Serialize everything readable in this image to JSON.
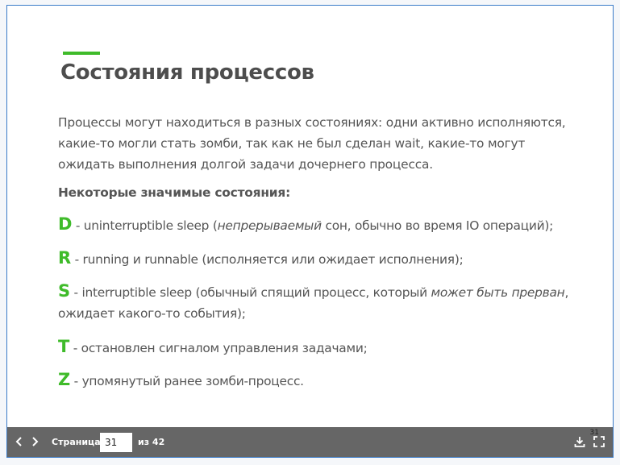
{
  "slide": {
    "title": "Состояния процессов",
    "intro": "Процессы могут находиться в разных состояниях: одни активно исполняются, какие-то могли стать зомби, так как не был сделан wait, какие-то могут ожидать выполнения долгой задачи дочернего процесса.",
    "subhead": "Некоторые значимые состояния:",
    "states": [
      {
        "letter": "D",
        "pre": " - uninterruptible sleep (",
        "italic": "непрерываемый",
        "post": " сон, обычно во время IO операций);"
      },
      {
        "letter": "R",
        "pre": " - running и runnable (исполняется или ожидает исполнения);",
        "italic": "",
        "post": ""
      },
      {
        "letter": "S",
        "pre": " - interruptible sleep (обычный спящий процесс, который ",
        "italic": "может быть прерван",
        "post": ", ожидает какого-то события);"
      },
      {
        "letter": "T",
        "pre": " - остановлен сигналом управления задачами;",
        "italic": "",
        "post": ""
      },
      {
        "letter": "Z",
        "pre": " - упомянутый ранее зомби-процесс.",
        "italic": "",
        "post": ""
      }
    ]
  },
  "toolbar": {
    "page_label": "Страница",
    "page_value": "31",
    "of_label": "из 42",
    "corner_number": "31"
  },
  "colors": {
    "accent": "#3fbb2a",
    "toolbar_bg": "#666666",
    "text": "#555555"
  },
  "icons": [
    "chevron-left-icon",
    "chevron-right-icon",
    "download-icon",
    "fullscreen-icon"
  ]
}
